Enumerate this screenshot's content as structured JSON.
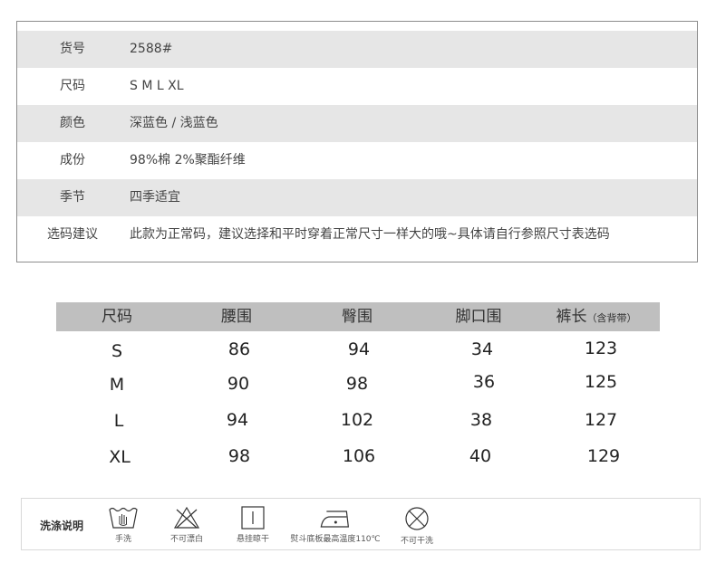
{
  "info": [
    {
      "key": "货号",
      "value": "2588#"
    },
    {
      "key": "尺码",
      "value": "S  M  L  XL"
    },
    {
      "key": "颜色",
      "value": "深蓝色 / 浅蓝色"
    },
    {
      "key": "成份",
      "value": "98%棉  2%聚酯纤维"
    },
    {
      "key": "季节",
      "value": "四季适宜"
    },
    {
      "key": "选码建议",
      "value": "此款为正常码，建议选择和平时穿着正常尺寸一样大的哦~具体请自行参照尺寸表选码"
    }
  ],
  "size_table": {
    "headers": [
      "尺码",
      "腰围",
      "臀围",
      "脚口围",
      "裤长"
    ],
    "length_note": "（含背带）",
    "rows": [
      [
        "S",
        "86",
        "94",
        "34",
        "123"
      ],
      [
        "M",
        "90",
        "98",
        "36",
        "125"
      ],
      [
        "L",
        "94",
        "102",
        "38",
        "127"
      ],
      [
        "XL",
        "98",
        "106",
        "40",
        "129"
      ]
    ]
  },
  "wash": {
    "title": "洗涤说明",
    "items": [
      {
        "icon": "hand-wash-icon",
        "label": "手洗"
      },
      {
        "icon": "no-bleach-icon",
        "label": "不可漂白"
      },
      {
        "icon": "hang-dry-icon",
        "label": "悬挂晾干"
      },
      {
        "icon": "iron-icon",
        "label": "熨斗底板最高温度110℃"
      },
      {
        "icon": "no-tumble-dry-icon",
        "label": "不可干洗"
      }
    ]
  }
}
